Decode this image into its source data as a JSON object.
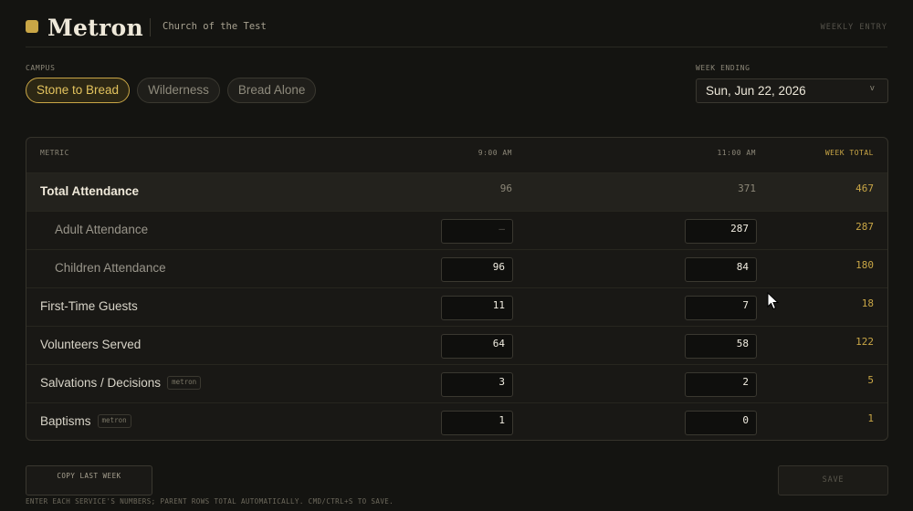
{
  "header": {
    "brand": "Metron",
    "church": "Church of the Test",
    "mode": "WEEKLY ENTRY",
    "accent": "#c9a646"
  },
  "campus": {
    "label": "CAMPUS",
    "options": [
      "Stone to Bread",
      "Wilderness",
      "Bread Alone"
    ],
    "selected": "Stone to Bread"
  },
  "week": {
    "label": "WEEK ENDING",
    "value": "Sun, Jun 22, 2026",
    "chevron": "v"
  },
  "table": {
    "headers": {
      "metric": "METRIC",
      "service1": "9:00 AM",
      "service2": "11:00 AM",
      "total": "WEEK TOTAL"
    },
    "rows": [
      {
        "label": "Total Attendance",
        "s1": "96",
        "s2": "371",
        "total": "467",
        "kind": "parent",
        "tag": ""
      },
      {
        "label": "Adult Attendance",
        "s1": "–",
        "s2": "287",
        "total": "287",
        "kind": "child",
        "tag": ""
      },
      {
        "label": "Children Attendance",
        "s1": "96",
        "s2": "84",
        "total": "180",
        "kind": "child",
        "tag": ""
      },
      {
        "label": "First-Time Guests",
        "s1": "11",
        "s2": "7",
        "total": "18",
        "kind": "normal",
        "tag": ""
      },
      {
        "label": "Volunteers Served",
        "s1": "64",
        "s2": "58",
        "total": "122",
        "kind": "normal",
        "tag": ""
      },
      {
        "label": "Salvations / Decisions",
        "s1": "3",
        "s2": "2",
        "total": "5",
        "kind": "normal",
        "tag": "metron"
      },
      {
        "label": "Baptisms",
        "s1": "1",
        "s2": "0",
        "total": "1",
        "kind": "normal",
        "tag": "metron"
      }
    ]
  },
  "footer": {
    "copy_label": "COPY LAST WEEK",
    "save_label": "SAVE",
    "hint": "ENTER EACH SERVICE'S NUMBERS; PARENT ROWS TOTAL AUTOMATICALLY. CMD/CTRL+S TO SAVE."
  }
}
